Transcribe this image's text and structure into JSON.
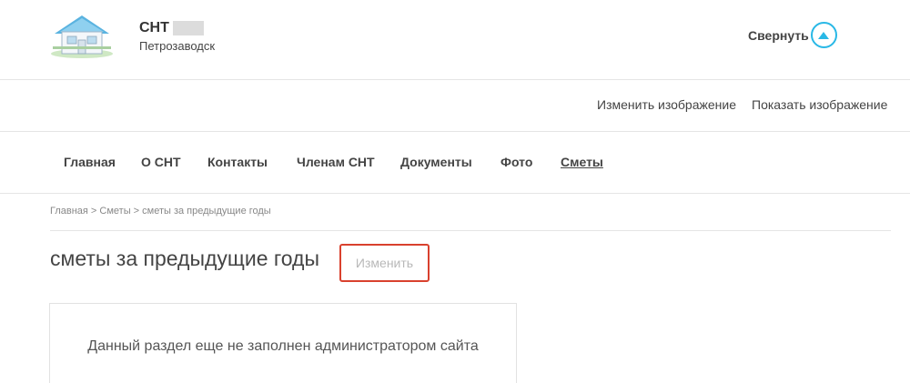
{
  "header": {
    "site_name": "СНТ",
    "city": "Петрозаводск",
    "collapse_label": "Свернуть"
  },
  "image_bar": {
    "change_image": "Изменить изображение",
    "show_image": "Показать изображение"
  },
  "nav": {
    "items": [
      {
        "label": "Главная"
      },
      {
        "label": "О СНТ"
      },
      {
        "label": "Контакты"
      },
      {
        "label": "Членам СНТ"
      },
      {
        "label": "Документы"
      },
      {
        "label": "Фото"
      },
      {
        "label": "Сметы"
      }
    ]
  },
  "breadcrumb": "Главная > Сметы > сметы за предыдущие годы",
  "page": {
    "title": "сметы за предыдущие годы",
    "edit_label": "Изменить",
    "empty_message": "Данный раздел еще не заполнен администратором сайта"
  },
  "colors": {
    "accent": "#29b8e6",
    "edit_border": "#d9412e"
  },
  "icons": {
    "logo": "house-logo-icon",
    "collapse": "chevron-up-icon"
  }
}
